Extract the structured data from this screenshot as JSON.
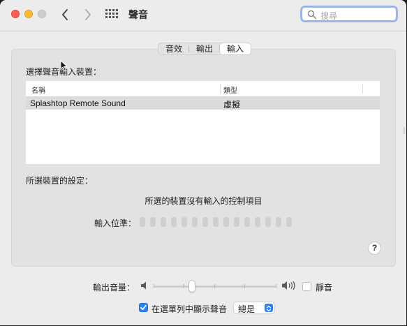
{
  "toolbar": {
    "title": "聲音",
    "search_placeholder": "搜尋"
  },
  "tabs": [
    {
      "label": "音效",
      "active": false
    },
    {
      "label": "輸出",
      "active": false
    },
    {
      "label": "輸入",
      "active": true
    }
  ],
  "input": {
    "select_device_label": "選擇聲音輸入裝置：",
    "columns": [
      "名稱",
      "類型"
    ],
    "devices": [
      {
        "name": "Splashtop Remote Sound",
        "type": "虛擬"
      }
    ],
    "selected_settings_label": "所選裝置的設定：",
    "no_controls_text": "所選的裝置沒有輸入的控制項目",
    "level_label": "輸入位準：",
    "level_segments": 15,
    "help_label": "?"
  },
  "bottom": {
    "output_volume_label": "輸出音量：",
    "output_volume_fraction": 0.3,
    "mute_label": "靜音",
    "mute_checked": false,
    "show_in_menu_label": "在選單列中顯示聲音",
    "show_in_menu_checked": true,
    "show_in_menu_option": "總是"
  },
  "colors": {
    "accent": "#2f7ff6",
    "close": "#ff5f57",
    "minimize": "#febc2e",
    "zoom_disabled": "#cdcdcd"
  }
}
